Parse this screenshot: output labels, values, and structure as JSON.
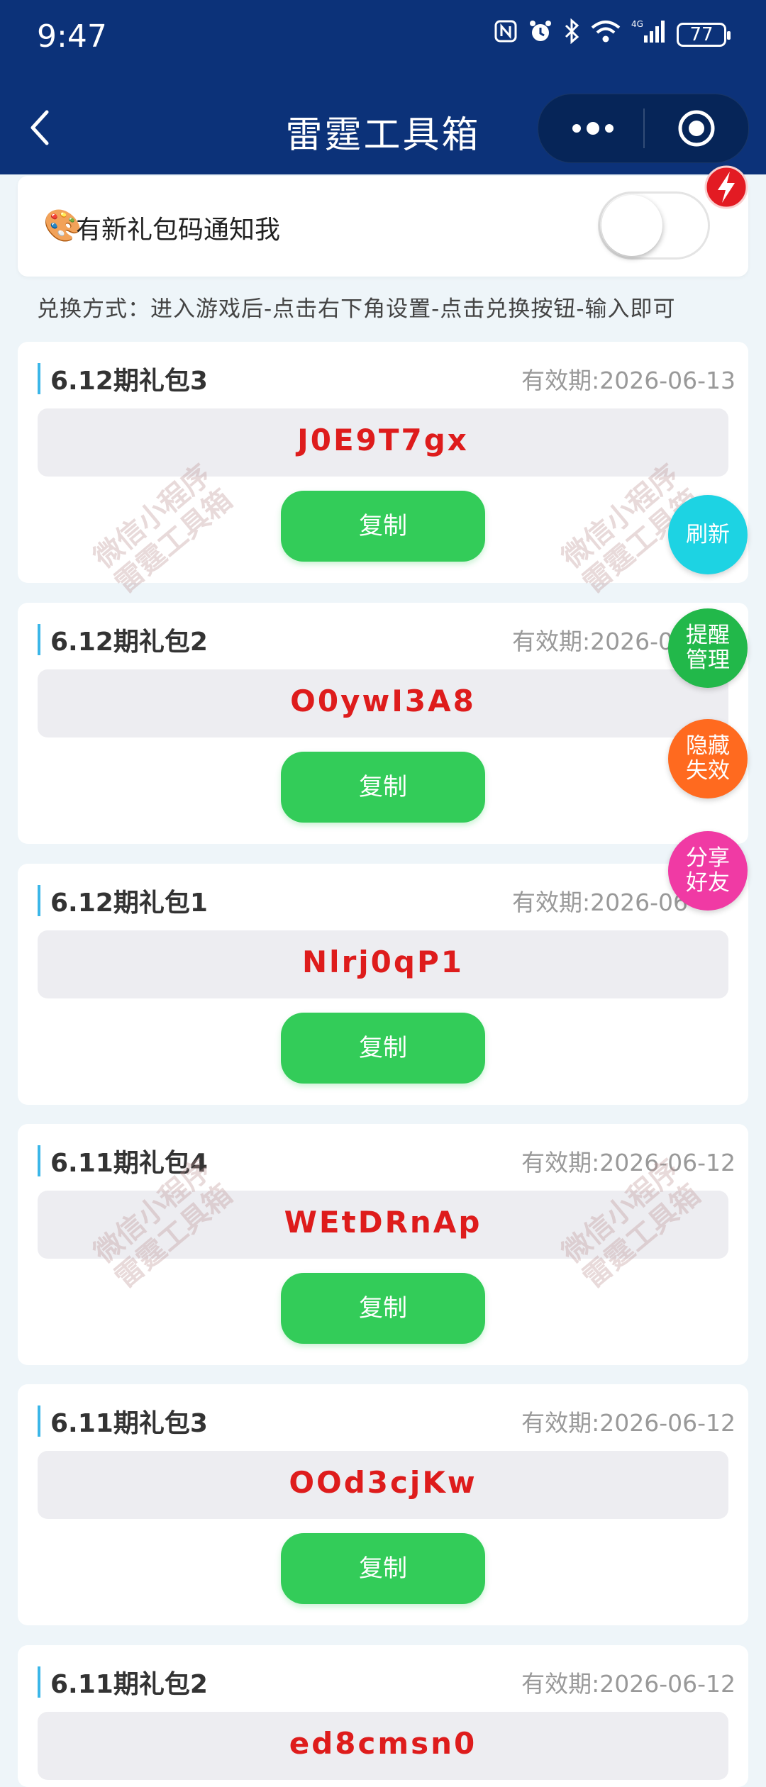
{
  "status_bar": {
    "time": "9:47",
    "battery": "77"
  },
  "nav": {
    "title": "雷霆工具箱"
  },
  "notify": {
    "emoji": "🎨",
    "label": "有新礼包码通知我"
  },
  "instructions": "兑换方式：进入游戏后-点击右下角设置-点击兑换按钮-输入即可",
  "gifts": [
    {
      "title": "6.12期礼包3",
      "expiry": "有效期:2026-06-13",
      "code": "J0E9T7gx",
      "copy_label": "复制"
    },
    {
      "title": "6.12期礼包2",
      "expiry": "有效期:2026-0",
      "code": "O0ywI3A8",
      "copy_label": "复制"
    },
    {
      "title": "6.12期礼包1",
      "expiry": "有效期:2026-06",
      "code": "Nlrj0qP1",
      "copy_label": "复制"
    },
    {
      "title": "6.11期礼包4",
      "expiry": "有效期:2026-06-12",
      "code": "WEtDRnAp",
      "copy_label": "复制"
    },
    {
      "title": "6.11期礼包3",
      "expiry": "有效期:2026-06-12",
      "code": "OOd3cjKw",
      "copy_label": "复制"
    },
    {
      "title": "6.11期礼包2",
      "expiry": "有效期:2026-06-12",
      "code": "ed8cmsn0",
      "copy_label": "复制"
    }
  ],
  "watermark": {
    "line1": "微信小程序",
    "line2": "雷霆工具箱"
  },
  "float_buttons": {
    "refresh": "刷新",
    "remind": "提醒管理",
    "hide": "隐藏失效",
    "share": "分享好友"
  },
  "colors": {
    "header_bg": "#0c3279",
    "accent_green": "#33cc59",
    "code_red": "#de1c1c",
    "refresh_cyan": "#1dd3e3",
    "remind_green": "#22b84a",
    "hide_orange": "#ff6a1f",
    "share_pink": "#f03aa4"
  }
}
